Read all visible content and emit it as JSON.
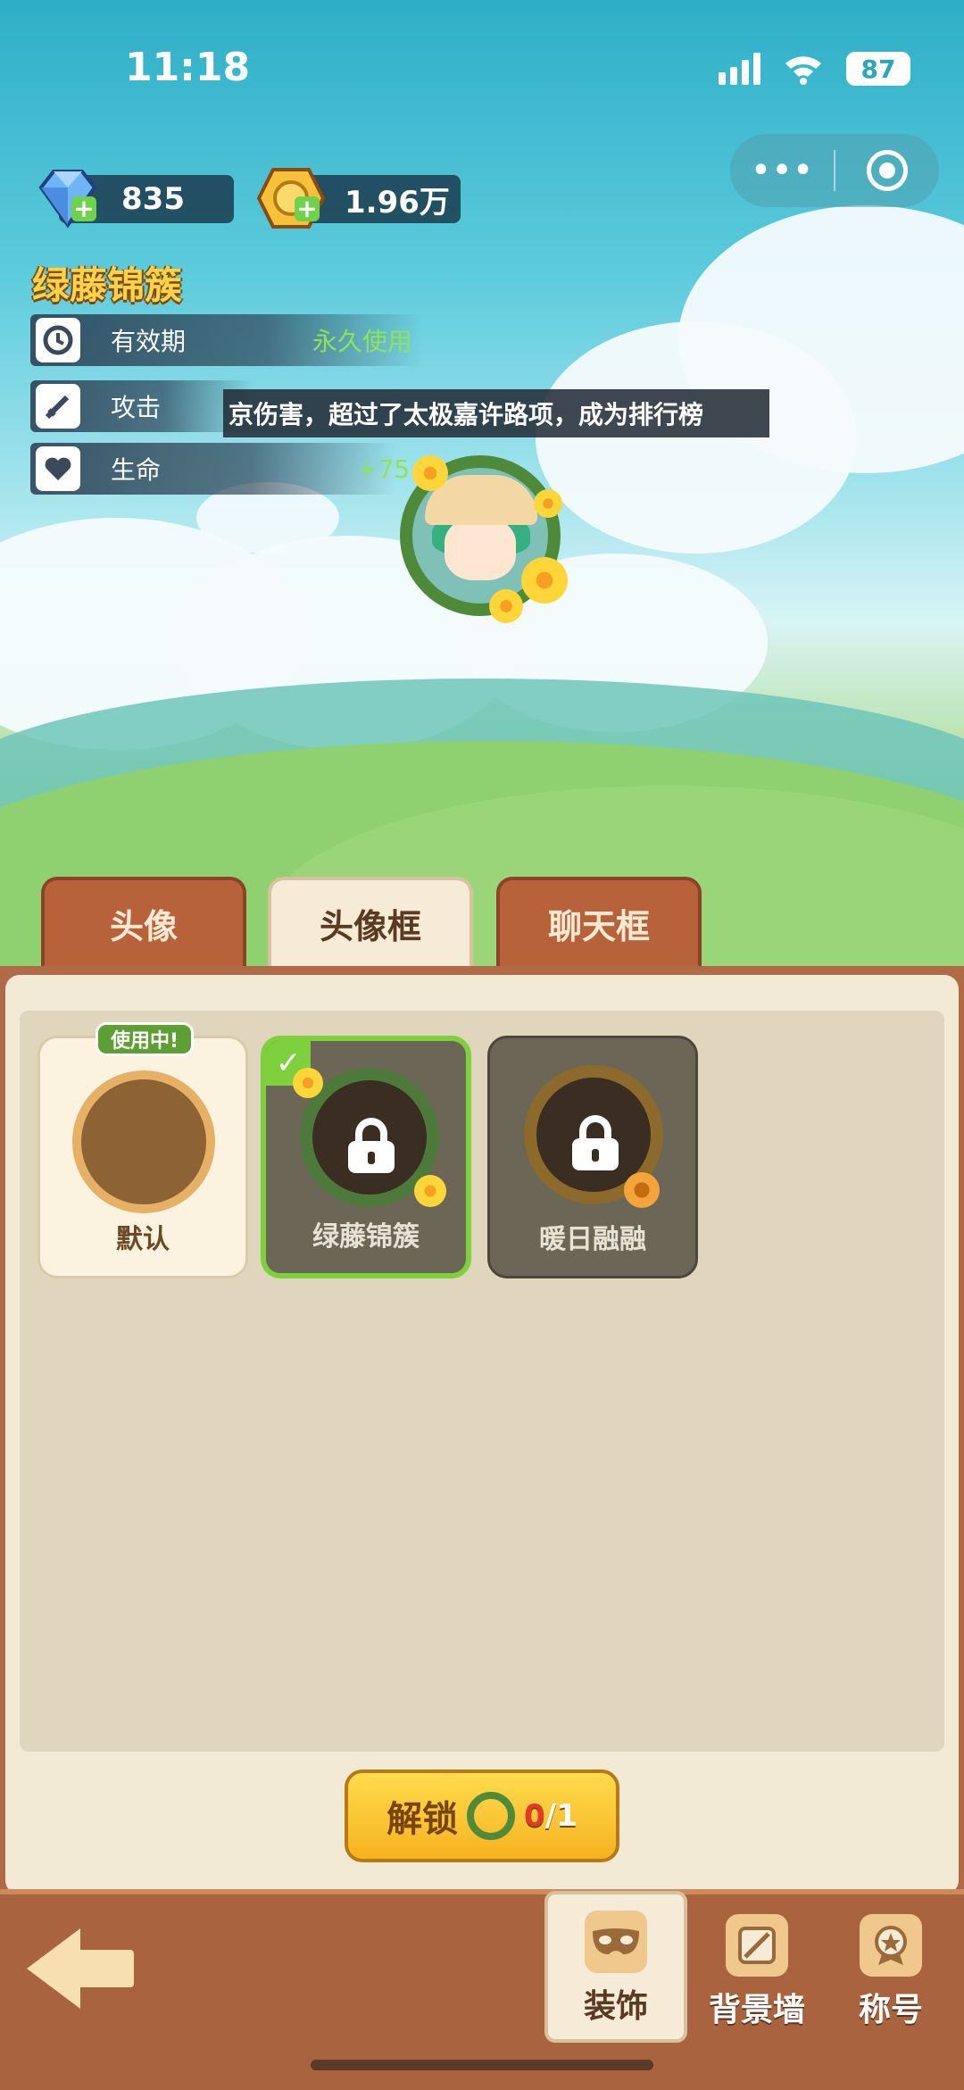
{
  "status": {
    "time": "11:18",
    "battery": "87"
  },
  "currency": {
    "diamond": {
      "icon": "diamond-icon",
      "value": "835"
    },
    "coin": {
      "icon": "coin-icon",
      "value": "1.96万"
    }
  },
  "frame": {
    "title": "绿藤锦簇",
    "stats": [
      {
        "icon": "clock-icon",
        "label": "有效期",
        "value": "永久使用"
      },
      {
        "icon": "sword-icon",
        "label": "攻击",
        "value": ""
      },
      {
        "icon": "heart-icon",
        "label": "生命",
        "value": "+75"
      }
    ],
    "ticker": "京伤害，超过了太极嘉许路项，成为排行榜"
  },
  "tabs": [
    {
      "label": "头像",
      "active": false
    },
    {
      "label": "头像框",
      "active": true
    },
    {
      "label": "聊天框",
      "active": false
    }
  ],
  "items": [
    {
      "label": "默认",
      "badge": "使用中!",
      "locked": false,
      "selected": false
    },
    {
      "label": "绿藤锦簇",
      "badge": "",
      "locked": true,
      "selected": true
    },
    {
      "label": "暖日融融",
      "badge": "",
      "locked": true,
      "selected": false
    }
  ],
  "unlock": {
    "label": "解锁",
    "owned": "0",
    "required": "/1"
  },
  "nav": [
    {
      "label": "装饰",
      "icon": "mask-icon",
      "active": true
    },
    {
      "label": "背景墙",
      "icon": "wall-icon",
      "active": false
    },
    {
      "label": "称号",
      "icon": "medal-icon",
      "active": false
    }
  ],
  "colors": {
    "accent": "#7ed13c",
    "title_gold": "#ffd24a",
    "panel": "#f3ead6",
    "wood": "#a9633f"
  }
}
